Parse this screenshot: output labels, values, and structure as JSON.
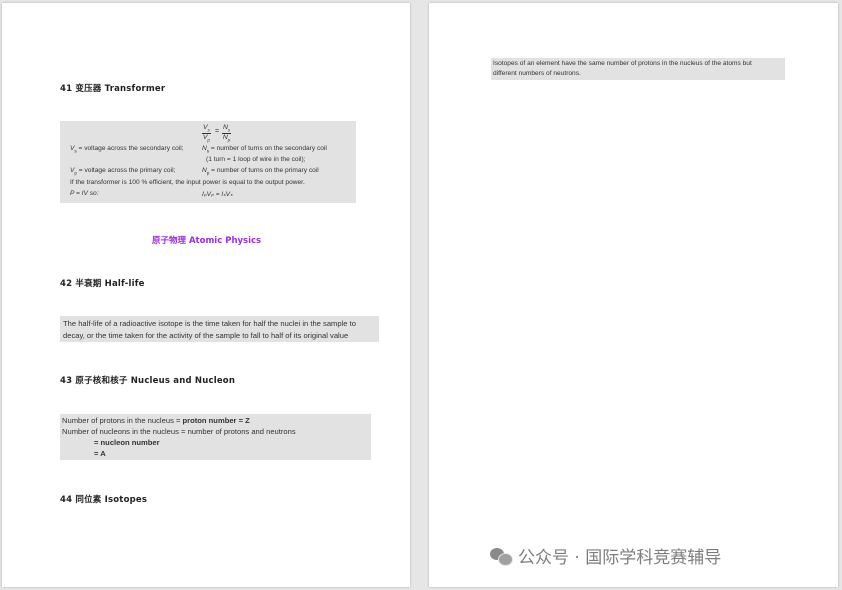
{
  "transformer": {
    "heading": "41 变压器 Transformer",
    "formula": {
      "num": "V",
      "num_sub": "s",
      "den": "V",
      "den_sub": "p",
      "eq": "=",
      "rnum": "N",
      "rnum_sub": "s",
      "rden": "N",
      "rden_sub": "p"
    },
    "rows": [
      {
        "left": "V",
        "left_sub": "s",
        "left_rest": " = voltage across the secondary coil;",
        "right": "N",
        "right_sub": "s",
        "right_rest": " = number of turns on the secondary coil"
      },
      {
        "right_cont": "(1 turn = 1 loop of wire in the coil);"
      },
      {
        "left": "V",
        "left_sub": "p",
        "left_rest": " = voltage across the primary coil;",
        "right": "N",
        "right_sub": "p",
        "right_rest": " = number of turns on the primary coil"
      }
    ],
    "efficiency": "If the transformer is 100 % efficient, the input power is equal to the output power.",
    "power_left": "P = IV so:",
    "power_right": "IₚVₚ = IₛVₛ"
  },
  "atomic_section": "原子物理 Atomic Physics",
  "halflife": {
    "heading": "42 半衰期 Half-life",
    "line1": "The half-life of a radioactive isotope is the time taken for half the nuclei in the sample to",
    "line2": "decay, or the time taken for the activity of the sample to fall to half of its original value"
  },
  "nucleus": {
    "heading": "43 原子核和核子 Nucleus and Nucleon",
    "line1_a": "Number of protons in the nucleus = ",
    "line1_b": "proton number = Z",
    "line2": "Number of nucleons in the nucleus = number of protons and neutrons",
    "line3": "= nucleon number",
    "line4": "= A"
  },
  "isotopes": {
    "heading": "44 同位素 Isotopes",
    "line1": "Isotopes of an element have the same number of protons in the nucleus of the atoms but",
    "line2": "different numbers of neutrons."
  },
  "watermark": "公众号 · 国际学科竞赛辅导"
}
